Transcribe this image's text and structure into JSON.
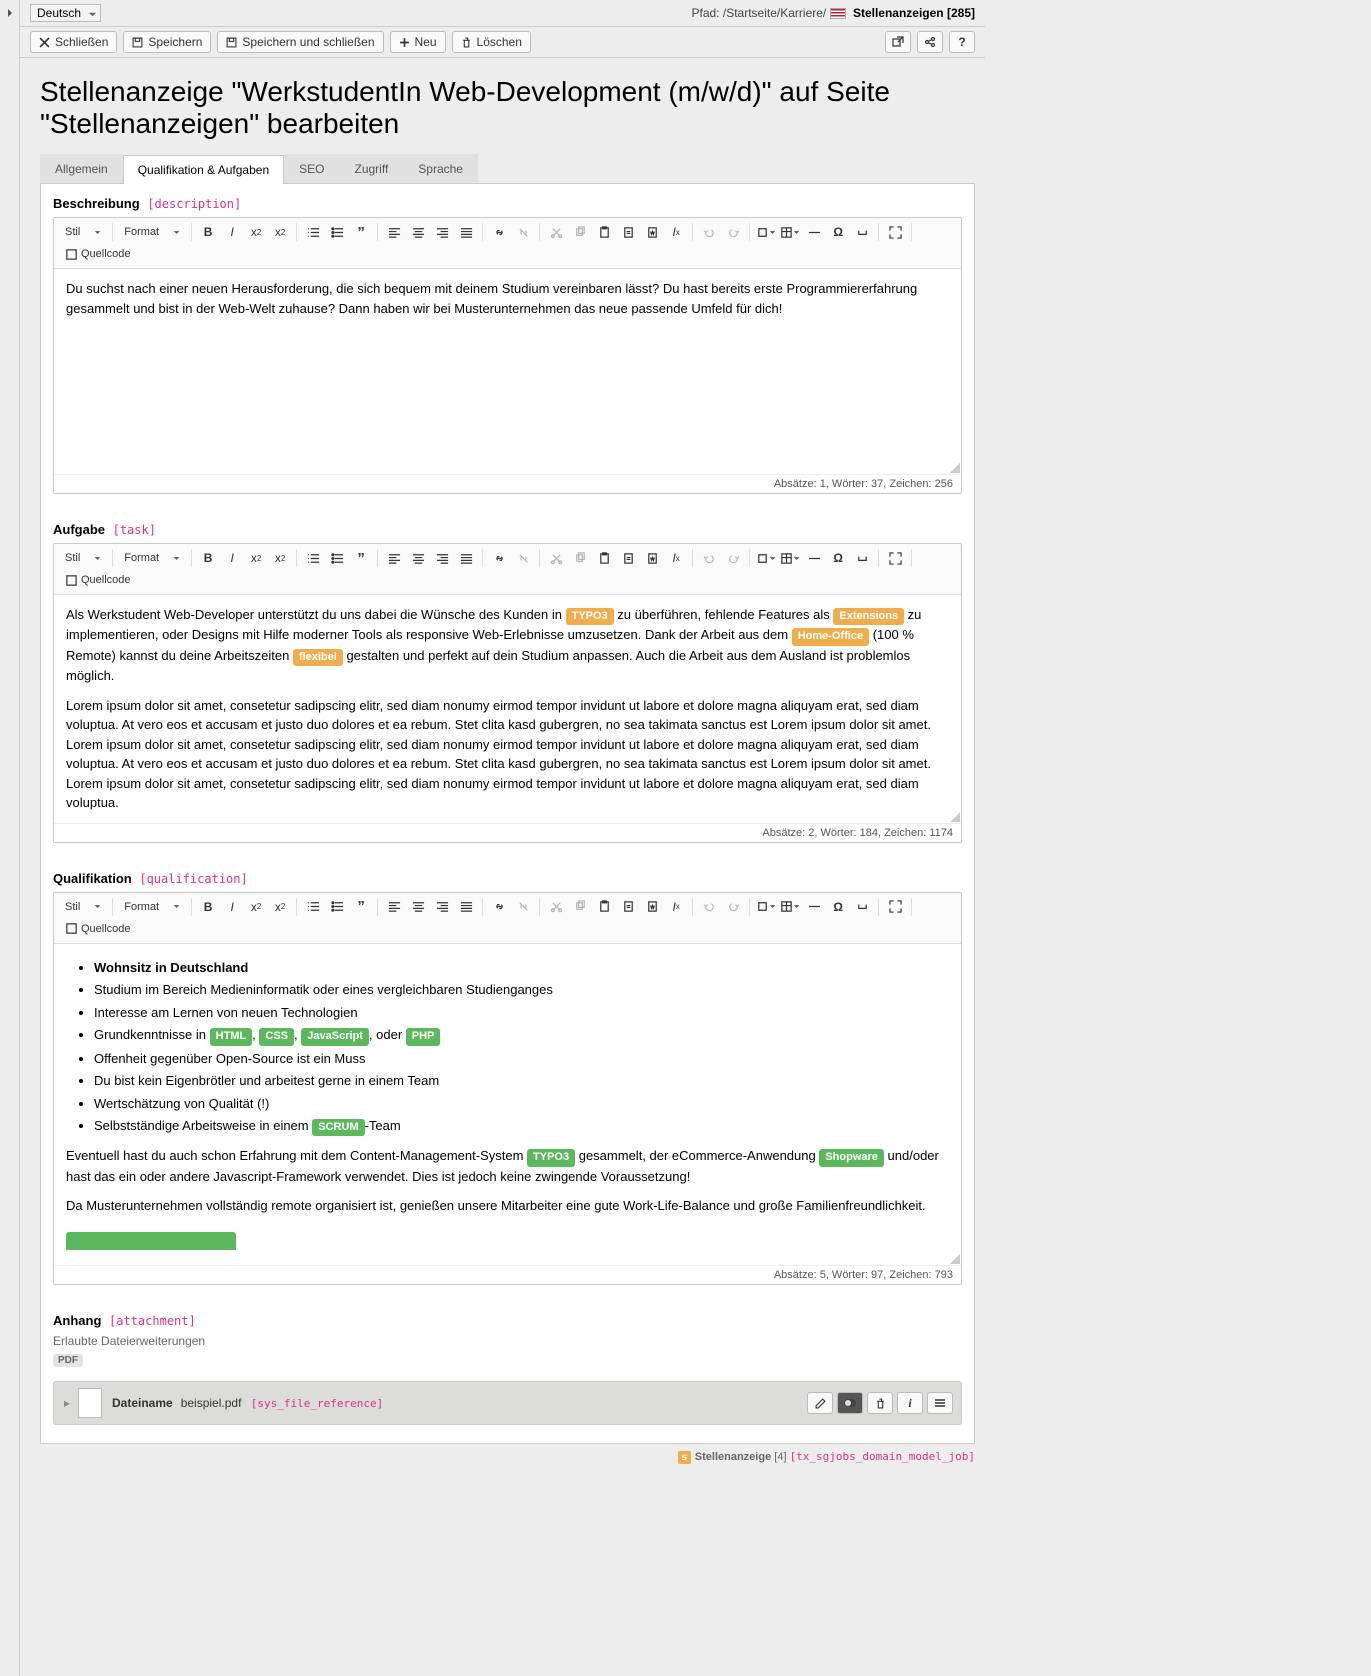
{
  "lang": "Deutsch",
  "breadcrumb": {
    "prefix": "Pfad:",
    "path": "/Startseite/Karriere/",
    "title": "Stellenanzeigen",
    "id": "[285]"
  },
  "toolbar": {
    "close": "Schließen",
    "save": "Speichern",
    "saveclose": "Speichern und schließen",
    "new": "Neu",
    "delete": "Löschen"
  },
  "page_title": "Stellenanzeige \"WerkstudentIn Web-Development (m/w/d)\" auf Seite \"Stellenanzeigen\" bearbeiten",
  "tabs": [
    "Allgemein",
    "Qualifikation & Aufgaben",
    "SEO",
    "Zugriff",
    "Sprache"
  ],
  "active_tab": 1,
  "rte": {
    "stil": "Stil",
    "format": "Format",
    "source": "Quellcode"
  },
  "fields": {
    "description": {
      "label": "Beschreibung",
      "key": "[description]",
      "text": "Du suchst nach einer neuen Herausforderung, die sich bequem mit deinem Studium vereinbaren lässt? Du hast bereits erste Programmiererfahrung gesammelt und bist in der Web-Welt zuhause? Dann haben wir bei Musterunternehmen das neue passende Umfeld für dich!",
      "status": "Absätze: 1, Wörter: 37, Zeichen: 256"
    },
    "task": {
      "label": "Aufgabe",
      "key": "[task]",
      "p1_a": "Als Werkstudent Web-Developer unterstützt du uns dabei die Wünsche des Kunden in ",
      "p1_b": " zu überführen, fehlende Features als ",
      "p1_c": " zu implementieren, oder Designs mit Hilfe moderner Tools als responsive Web-Erlebnisse umzusetzen. Dank der Arbeit aus dem ",
      "p1_d": " (100 % Remote) kannst du deine Arbeitszeiten ",
      "p1_e": " gestalten und perfekt auf dein Studium anpassen. Auch die Arbeit aus dem Ausland ist problemlos möglich.",
      "tag_typo3": "TYPO3",
      "tag_ext": "Extensions",
      "tag_home": "Home-Office",
      "tag_flex": "flexibel",
      "p2": "Lorem ipsum dolor sit amet, consetetur sadipscing elitr, sed diam nonumy eirmod tempor invidunt ut labore et dolore magna aliquyam erat, sed diam voluptua. At vero eos et accusam et justo duo dolores et ea rebum. Stet clita kasd gubergren, no sea takimata sanctus est Lorem ipsum dolor sit amet. Lorem ipsum dolor sit amet, consetetur sadipscing elitr, sed diam nonumy eirmod tempor invidunt ut labore et dolore magna aliquyam erat, sed diam voluptua. At vero eos et accusam et justo duo dolores et ea rebum. Stet clita kasd gubergren, no sea takimata sanctus est Lorem ipsum dolor sit amet. Lorem ipsum dolor sit amet, consetetur sadipscing elitr, sed diam nonumy eirmod tempor invidunt ut labore et dolore magna aliquyam erat, sed diam voluptua.",
      "status": "Absätze: 2, Wörter: 184, Zeichen: 1174"
    },
    "qualification": {
      "label": "Qualifikation",
      "key": "[qualification]",
      "li1": "Wohnsitz in Deutschland",
      "li2": "Studium im Bereich Medieninformatik oder eines vergleichbaren Studienganges",
      "li3": "Interesse am Lernen von neuen Technologien",
      "li4_a": "Grundkenntnisse in ",
      "tag_html": "HTML",
      "li4_b": ", ",
      "tag_css": "CSS",
      "li4_c": ", ",
      "tag_js": "JavaScript",
      "li4_d": ", oder ",
      "tag_php": "PHP",
      "li5": "Offenheit gegenüber Open-Source ist ein Muss",
      "li6": "Du bist kein Eigenbrötler und arbeitest gerne in einem Team",
      "li7": "Wertschätzung von Qualität (!)",
      "li8_a": "Selbstständige Arbeitsweise in einem ",
      "tag_scrum": "SCRUM",
      "li8_b": "-Team",
      "p2_a": "Eventuell hast du auch schon Erfahrung mit dem Content-Management-System ",
      "tag_typo3": "TYPO3",
      "p2_b": " gesammelt, der eCommerce-Anwendung ",
      "tag_shop": "Shopware",
      "p2_c": " und/oder hast das ein oder andere Javascript-Framework verwendet. Dies ist jedoch keine zwingende Voraussetzung!",
      "p3": "Da Musterunternehmen vollständig remote organisiert ist, genießen unsere Mitarbeiter eine gute Work-Life-Balance und große Familienfreundlichkeit.",
      "status": "Absätze: 5, Wörter: 97, Zeichen: 793"
    },
    "attachment": {
      "label": "Anhang",
      "key": "[attachment]",
      "allowed_label": "Erlaubte Dateierweiterungen",
      "ext": "PDF",
      "fname_label": "Dateiname",
      "fname": "beispiel.pdf",
      "ref": "[sys_file_reference]"
    }
  },
  "footer": {
    "type": "Stellenanzeige",
    "count": "[4]",
    "table": "[tx_sgjobs_domain_model_job]"
  }
}
